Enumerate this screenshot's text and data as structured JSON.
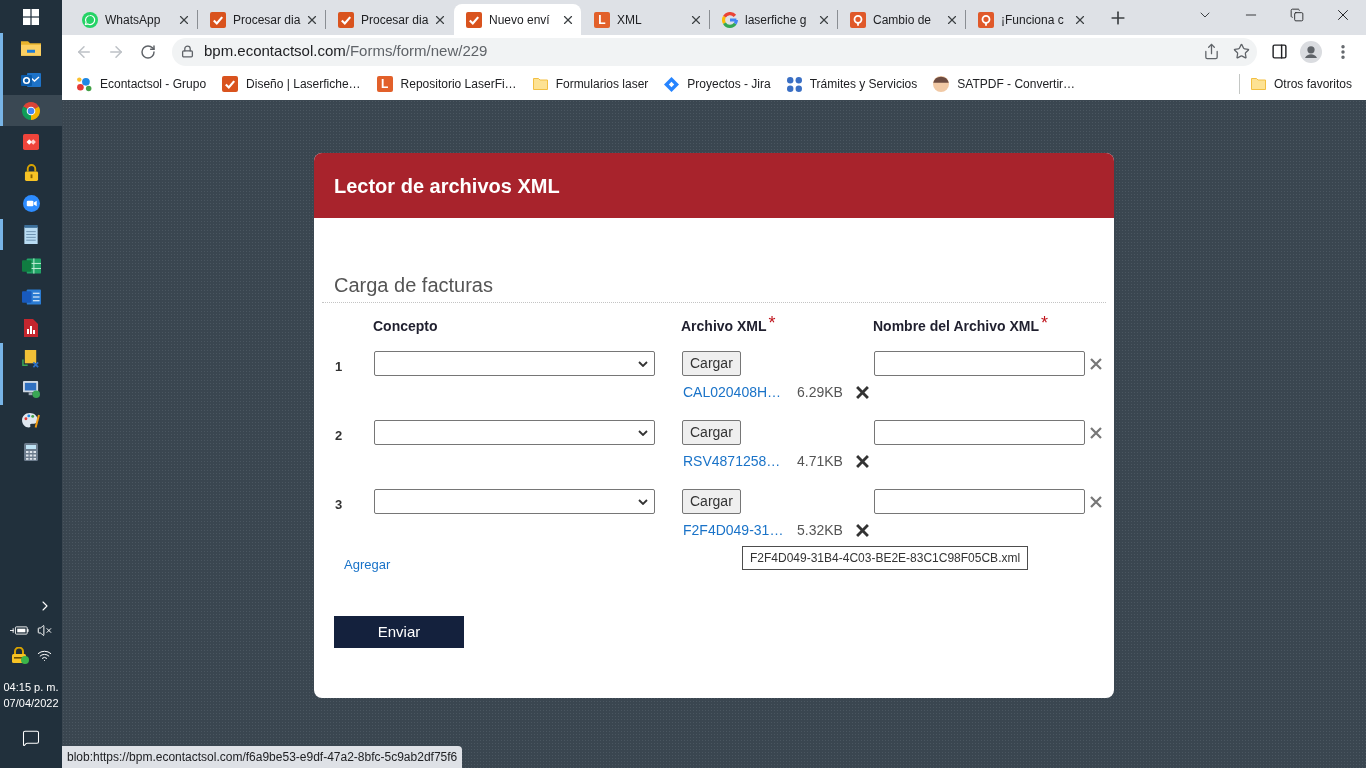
{
  "taskbar": {
    "apps": [
      {
        "running": true,
        "selected": false
      },
      {
        "running": true,
        "selected": false
      },
      {
        "running": true,
        "selected": true
      },
      {
        "running": false,
        "selected": false
      },
      {
        "running": false,
        "selected": false
      },
      {
        "running": false,
        "selected": false
      },
      {
        "running": true,
        "selected": false
      },
      {
        "running": false,
        "selected": false
      },
      {
        "running": false,
        "selected": false
      },
      {
        "running": false,
        "selected": false
      },
      {
        "running": true,
        "selected": false
      },
      {
        "running": true,
        "selected": false
      },
      {
        "running": false,
        "selected": false
      },
      {
        "running": false,
        "selected": false
      }
    ],
    "clock": {
      "time": "04:15 p. m.",
      "date": "07/04/2022"
    }
  },
  "tabs": [
    {
      "title": "WhatsApp",
      "selected": false
    },
    {
      "title": "Procesar dia",
      "selected": false
    },
    {
      "title": "Procesar dia",
      "selected": false
    },
    {
      "title": "Nuevo enví",
      "selected": true
    },
    {
      "title": "XML",
      "logo_letter": "L",
      "selected": false
    },
    {
      "title": "laserfiche g",
      "selected": false
    },
    {
      "title": "Cambio de",
      "selected": false
    },
    {
      "title": "¡Funciona c",
      "selected": false
    }
  ],
  "toolbar": {
    "back": {
      "disabled": true
    },
    "forward": {
      "disabled": true
    },
    "url_host": "bpm.econtactsol.com",
    "url_path": "/Forms/form/new/229"
  },
  "bookmarks": [
    {
      "label": "Econtactsol - Grupo"
    },
    {
      "label": "Diseño | Laserfiche…"
    },
    {
      "label": "Repositorio LaserFi…",
      "logo_letter": "L"
    },
    {
      "label": "Formularios laser"
    },
    {
      "label": "Proyectos - Jira"
    },
    {
      "label": "Trámites y Servicios"
    },
    {
      "label": "SATPDF - Convertir…"
    }
  ],
  "other_bookmarks": "Otros favoritos",
  "form": {
    "title": "Lector de archivos XML",
    "section_title": "Carga de facturas",
    "columns": [
      {
        "label": "Concepto"
      },
      {
        "label": "Archivo XML",
        "required_mark": "*"
      },
      {
        "label": "Nombre del Archivo XML",
        "required_mark": "*"
      }
    ],
    "rows": [
      {
        "number": "1",
        "upload_button": "Cargar",
        "file_name": "CAL020408H…",
        "file_size": "6.29KB"
      },
      {
        "number": "2",
        "upload_button": "Cargar",
        "file_name": "RSV4871258…",
        "file_size": "4.71KB"
      },
      {
        "number": "3",
        "upload_button": "Cargar",
        "file_name": "F2F4D049-31…",
        "file_size": "5.32KB"
      }
    ],
    "add_link": "Agregar",
    "submit_button": "Enviar"
  },
  "tooltip": "F2F4D049-31B4-4C03-BE2E-83C1C98F05CB.xml",
  "status_url": "blob:https://bpm.econtactsol.com/f6a9be53-e9df-47a2-8bfc-5c9ab2df75f6"
}
